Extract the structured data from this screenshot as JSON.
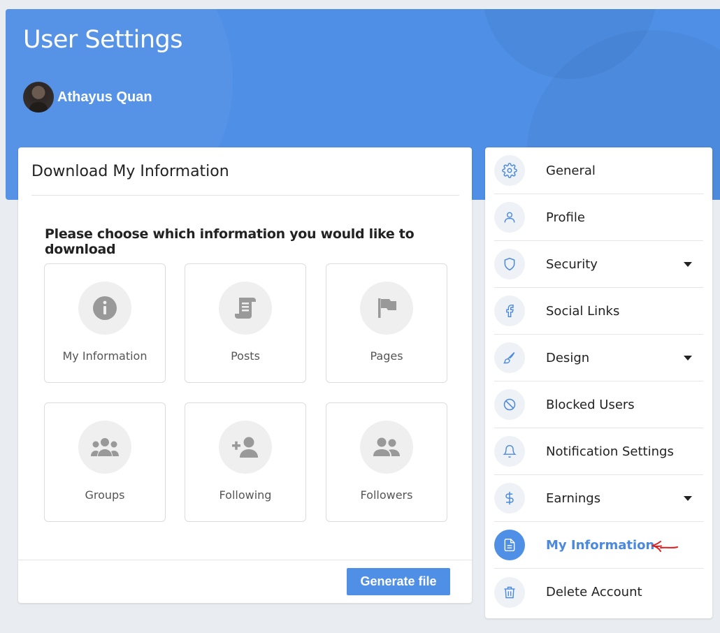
{
  "header": {
    "title": "User Settings",
    "user_name": "Athayus Quan"
  },
  "download": {
    "title": "Download My Information",
    "subtitle": "Please choose which information you would like to download",
    "options": [
      {
        "label": "My Information",
        "icon": "info-icon"
      },
      {
        "label": "Posts",
        "icon": "scroll-icon"
      },
      {
        "label": "Pages",
        "icon": "flag-icon"
      },
      {
        "label": "Groups",
        "icon": "users-icon"
      },
      {
        "label": "Following",
        "icon": "user-plus-icon"
      },
      {
        "label": "Followers",
        "icon": "user-friends-icon"
      }
    ],
    "generate_label": "Generate file"
  },
  "menu": {
    "items": [
      {
        "label": "General",
        "icon": "gear-icon"
      },
      {
        "label": "Profile",
        "icon": "user-icon"
      },
      {
        "label": "Security",
        "icon": "shield-icon",
        "has_dropdown": true
      },
      {
        "label": "Social Links",
        "icon": "facebook-icon"
      },
      {
        "label": "Design",
        "icon": "brush-icon",
        "has_dropdown": true
      },
      {
        "label": "Blocked Users",
        "icon": "block-icon"
      },
      {
        "label": "Notification Settings",
        "icon": "bell-icon"
      },
      {
        "label": "Earnings",
        "icon": "dollar-icon",
        "has_dropdown": true
      },
      {
        "label": "My Information",
        "icon": "file-text-icon",
        "active": true
      },
      {
        "label": "Delete Account",
        "icon": "trash-icon"
      }
    ]
  },
  "colors": {
    "accent": "#4f8fe6",
    "active_text": "#4a89dc",
    "annotation": "#e02020"
  }
}
